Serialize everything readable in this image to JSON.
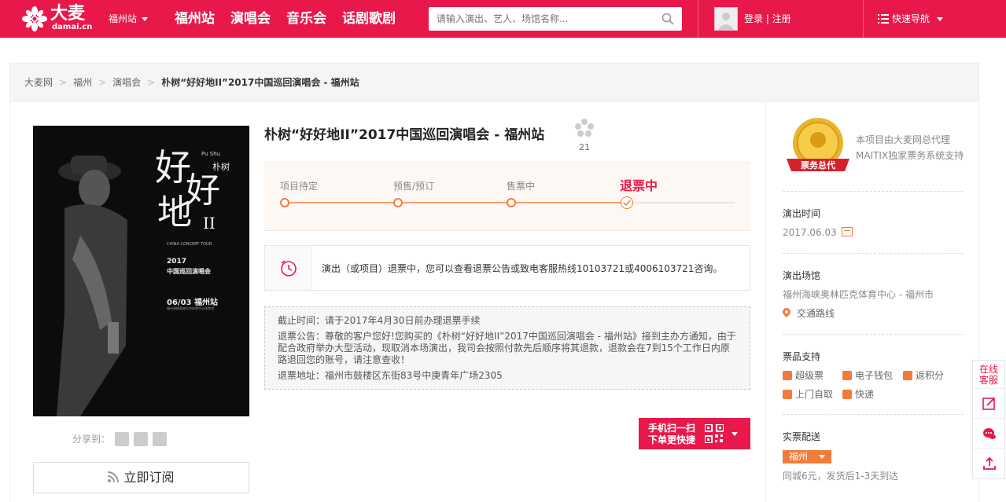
{
  "header": {
    "logo_text": "大麦",
    "logo_domain": "damai.cn",
    "city": "福州站",
    "nav": [
      "福州站",
      "演唱会",
      "音乐会",
      "话剧歌剧"
    ],
    "search_placeholder": "请输入演出、艺人、场馆名称...",
    "login": "登录 | 注册",
    "quick_nav": "快速导航"
  },
  "breadcrumb": [
    "大麦网",
    "福州",
    "演唱会",
    "朴树“好好地II”2017中国巡回演唱会 - 福州站"
  ],
  "poster": {
    "pushu": "Pu Shu",
    "name": "朴树",
    "title_chars": [
      "好",
      "好",
      "地",
      "II"
    ],
    "tour_en": "CHINA CONCERT TOUR",
    "year": "2017",
    "tour_cn": "中国巡回演唱会",
    "date_city": "06/03 福州站",
    "venue_small": "福州海峡奥林匹克体育中心体育馆"
  },
  "share": {
    "label": "分享到："
  },
  "subscribe": {
    "label": "立即订阅"
  },
  "event": {
    "title": "朴树“好好地II”2017中国巡回演唱会 - 福州站",
    "fav_count": "21"
  },
  "progress": {
    "steps": [
      "项目待定",
      "预售/预订",
      "售票中",
      "退票中"
    ],
    "active_index": 3
  },
  "notice": {
    "text": "演出（或项目）退票中，您可以查看退票公告或致电客服热线10103721或4006103721咨询。"
  },
  "refund": {
    "deadline": "截止时间：请于2017年4月30日前办理退票手续",
    "announcement": "退票公告：尊敬的客户您好!您购买的《朴树“好好地II”2017中国巡回演唱会 - 福州站》接到主办方通知，由于配合政府举办大型活动，现取消本场演出，我司会按照付款先后顺序将其退款，退款会在7到15个工作日内原路退回您的账号，请注意查收！",
    "address": "退票地址：福州市鼓楼区东街83号中庚青年广场2305"
  },
  "mobile_buy": {
    "line1": "手机扫一扫",
    "line2": "下单更快捷"
  },
  "right": {
    "medal_text": "票务总代",
    "agent_line1": "本项目由大麦网总代理",
    "agent_line2": "MAITIX独家票务系统支持",
    "time_label": "演出时间",
    "time_value": "2017.06.03",
    "venue_label": "演出场馆",
    "venue_value": "福州海峡奥林匹克体育中心 - 福州市",
    "route_label": "交通路线",
    "support_label": "票品支持",
    "support_items": [
      "超级票",
      "电子钱包",
      "返积分",
      "上门自取",
      "快递"
    ],
    "delivery_label": "实票配送",
    "delivery_city": "福州",
    "delivery_note": "同城6元，发货后1-3天到达"
  },
  "side": {
    "service": "在线客服"
  },
  "colors": {
    "brand": "#e8194a",
    "accent": "#f07c3b"
  }
}
